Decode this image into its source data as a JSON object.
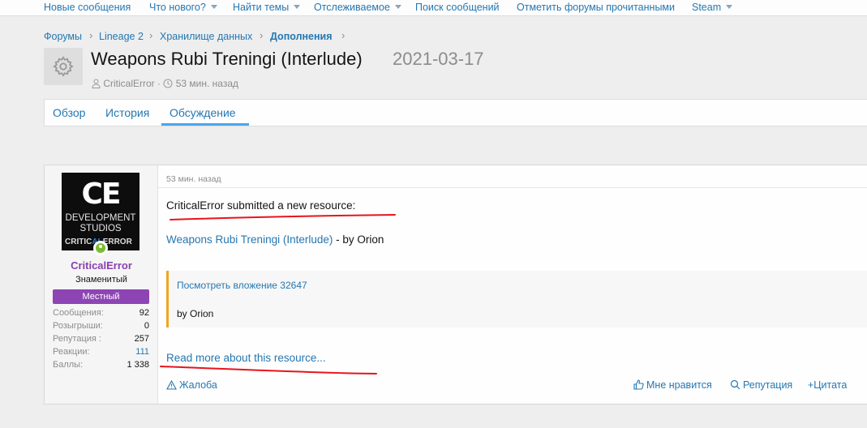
{
  "topnav": {
    "items": [
      {
        "label": "Новые сообщения",
        "dropdown": false
      },
      {
        "label": "Что нового?",
        "dropdown": true
      },
      {
        "label": "Найти темы",
        "dropdown": true
      },
      {
        "label": "Отслеживаемое",
        "dropdown": true
      },
      {
        "label": "Поиск сообщений",
        "dropdown": false
      },
      {
        "label": "Отметить форумы прочитанными",
        "dropdown": false
      },
      {
        "label": "Steam",
        "dropdown": true
      }
    ]
  },
  "breadcrumb": [
    "Форумы",
    "Lineage 2",
    "Хранилище данных",
    "Дополнения"
  ],
  "resource": {
    "icon": "gear-icon",
    "title": "Weapons Rubi Treningi (Interlude)",
    "version": "2021-03-17",
    "author": "CriticalError",
    "time": "53 мин. назад"
  },
  "tabs": [
    "Обзор",
    "История",
    "Обсуждение"
  ],
  "active_tab": "Обсуждение",
  "user": {
    "avatar_text": {
      "big": "CE",
      "line1": "DEVELOPMENT",
      "line2": "STUDIOS",
      "crit_a": "CRITIC",
      "crit_b": "AL",
      "crit_c": "ERROR"
    },
    "name": "CriticalError",
    "title": "Знаменитый",
    "banner": "Местный",
    "stats": [
      {
        "label": "Сообщения:",
        "value": "92"
      },
      {
        "label": "Розыгрыши:",
        "value": "0"
      },
      {
        "label": "Репутация :",
        "value": "257"
      },
      {
        "label": "Реакции:",
        "value": "111"
      },
      {
        "label": "Баллы:",
        "value": "1 338"
      }
    ]
  },
  "post": {
    "date": "53 мин. назад",
    "line1": "CriticalError submitted a new resource:",
    "resource_link": "Weapons Rubi Treningi (Interlude)",
    "by": " - by Orion",
    "attachment_link": "Посмотреть вложение 32647",
    "quote_text": "by Orion",
    "read_more": "Read more about this resource...",
    "actions": {
      "report": "Жалоба",
      "like": "Мне нравится",
      "reputation": "Репутация",
      "quote": "+Цитата"
    }
  },
  "colors": {
    "link": "#2577b1",
    "username": "#8a3fb0",
    "banner": "#8e45b4",
    "quote_border": "#f0a622",
    "tab_active": "#47a7eb",
    "annotation": "#e8141c"
  }
}
